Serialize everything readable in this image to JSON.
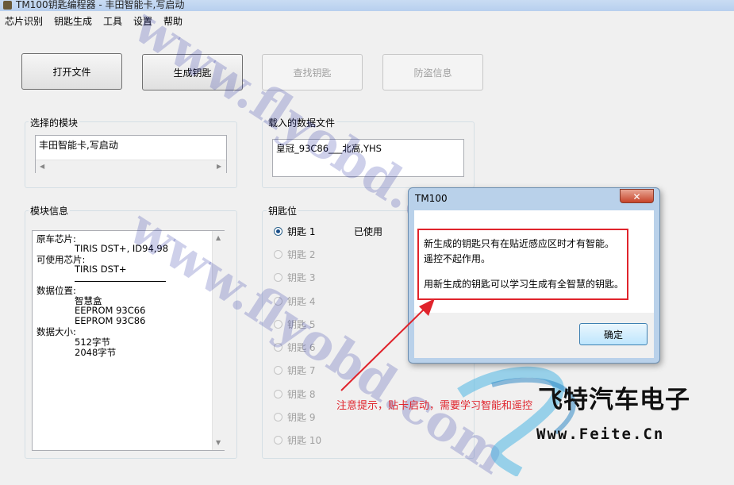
{
  "window": {
    "title": "TM100钥匙编程器 - 丰田智能卡,写启动"
  },
  "menu": [
    "芯片识别",
    "钥匙生成",
    "工具",
    "设置",
    "帮助"
  ],
  "toolbar": {
    "open_file": "打开文件",
    "generate_key": "生成钥匙",
    "find_key": "查找钥匙",
    "anti_theft": "防盗信息"
  },
  "selected_module": {
    "label": "选择的模块",
    "value": "丰田智能卡,写启动"
  },
  "loaded_file": {
    "label": "载入的数据文件",
    "value": "皇冠_93C86___北高,YHS"
  },
  "module_info": {
    "label": "模块信息",
    "lines": [
      "原车芯片:",
      "TIRIS DST+, ID94,98",
      "可使用芯片:",
      "TIRIS DST+",
      "数据位置:",
      "智慧盒",
      "EEPROM 93C66",
      "EEPROM 93C86",
      "数据大小:",
      "512字节",
      "2048字节"
    ]
  },
  "key_slots": {
    "label": "钥匙位",
    "used_text": "已使用",
    "selected_index": 0,
    "items": [
      "钥匙 1",
      "钥匙 2",
      "钥匙 3",
      "钥匙 4",
      "钥匙 5",
      "钥匙 6",
      "钥匙 7",
      "钥匙 8",
      "钥匙 9",
      "钥匙 10"
    ]
  },
  "dialog": {
    "title": "TM100",
    "close_symbol": "✕",
    "messages": [
      "新生成的钥匙只有在贴近感应区时才有智能。",
      "遥控不起作用。",
      "用新生成的钥匙可以学习生成有全智慧的钥匙。"
    ],
    "ok_label": "确定",
    "highlight_color": "#e0242c"
  },
  "annotation": {
    "text": "注意提示，贴卡启动，需要学习智能和遥控",
    "color": "#e0242c"
  },
  "watermark": {
    "text": "www.flyobd.com"
  },
  "brand": {
    "name": "飞特汽车电子",
    "url": "Www.Feite.Cn"
  }
}
